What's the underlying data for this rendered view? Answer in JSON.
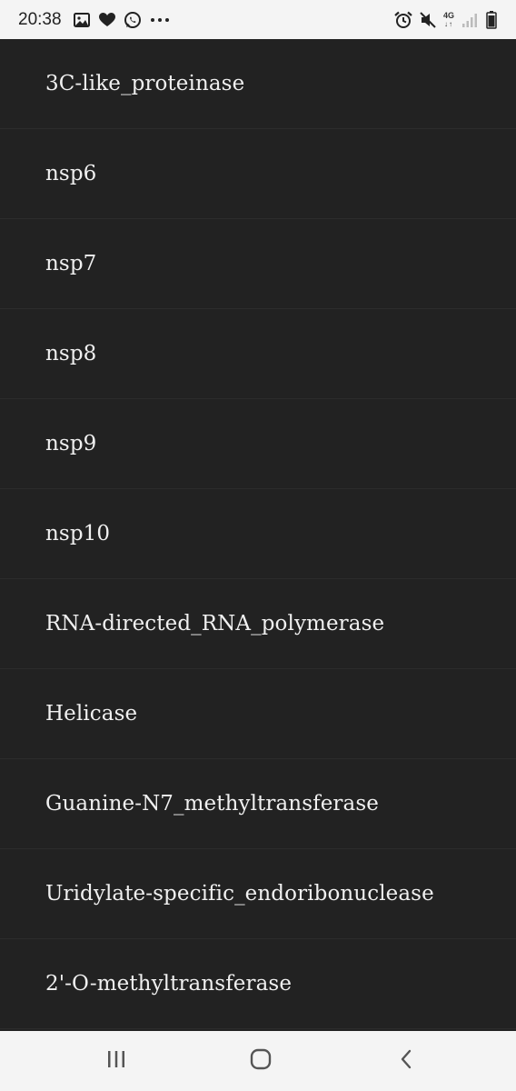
{
  "status_bar": {
    "time": "20:38",
    "network_label": "4G",
    "left_icons": [
      "image-icon",
      "heart-icon",
      "whatsapp-icon",
      "more-dots-icon"
    ],
    "right_icons": [
      "alarm-icon",
      "mute-icon",
      "network-4g-icon",
      "signal-icon",
      "battery-icon"
    ]
  },
  "list": {
    "items": [
      {
        "label": "3C-like_proteinase"
      },
      {
        "label": "nsp6"
      },
      {
        "label": "nsp7"
      },
      {
        "label": "nsp8"
      },
      {
        "label": "nsp9"
      },
      {
        "label": "nsp10"
      },
      {
        "label": "RNA-directed_RNA_polymerase"
      },
      {
        "label": "Helicase"
      },
      {
        "label": "Guanine-N7_methyltransferase"
      },
      {
        "label": "Uridylate-specific_endoribonuclease"
      },
      {
        "label": "2'-O-methyltransferase"
      }
    ]
  },
  "nav_bar": {
    "buttons": [
      "recent-apps-icon",
      "home-icon",
      "back-icon"
    ]
  },
  "colors": {
    "background": "#222222",
    "text": "#f0f0f0",
    "system_bar": "#f4f4f4"
  }
}
